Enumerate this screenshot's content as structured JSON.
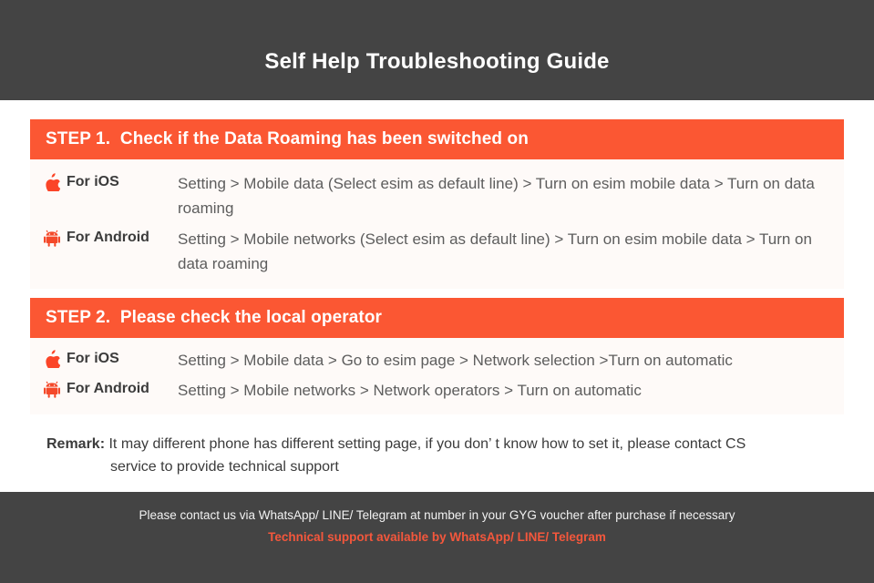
{
  "header": {
    "title": "Self Help Troubleshooting Guide",
    "background_color": "#444444",
    "text_color": "#ffffff"
  },
  "theme": {
    "accent_color": "#fb5733",
    "panel_background": "#fefaf8",
    "body_text_color": "#5d5d5d",
    "label_text_color": "#3b3b3b",
    "footer_accent_color": "#f4573c"
  },
  "steps": [
    {
      "number_label": "STEP 1.",
      "banner_title": "Check if the Data Roaming has been switched on",
      "rows": [
        {
          "icon": "apple-icon",
          "os_label": "For iOS",
          "path": "Setting > Mobile data (Select esim as default line) > Turn on esim mobile data > Turn on data roaming"
        },
        {
          "icon": "android-icon",
          "os_label": "For Android",
          "path": "Setting > Mobile networks (Select esim as default line) > Turn on esim mobile data > Turn on data roaming"
        }
      ]
    },
    {
      "number_label": "STEP 2.",
      "banner_title": "Please check the local operator",
      "rows": [
        {
          "icon": "apple-icon",
          "os_label": "For iOS",
          "path": "Setting > Mobile data > Go to esim page > Network selection >Turn on automatic"
        },
        {
          "icon": "android-icon",
          "os_label": "For Android",
          "path": "Setting > Mobile networks > Network operators > Turn on automatic"
        }
      ]
    }
  ],
  "remark": {
    "label": "Remark:",
    "line1": " It may different phone has different setting page, if you don’ t know how to set it,  please contact CS",
    "line2": "service to provide technical support"
  },
  "footer": {
    "line1": "Please contact us via WhatsApp/ LINE/ Telegram at number in your GYG voucher after purchase if necessary",
    "line2": "Technical support available by WhatsApp/ LINE/ Telegram"
  }
}
